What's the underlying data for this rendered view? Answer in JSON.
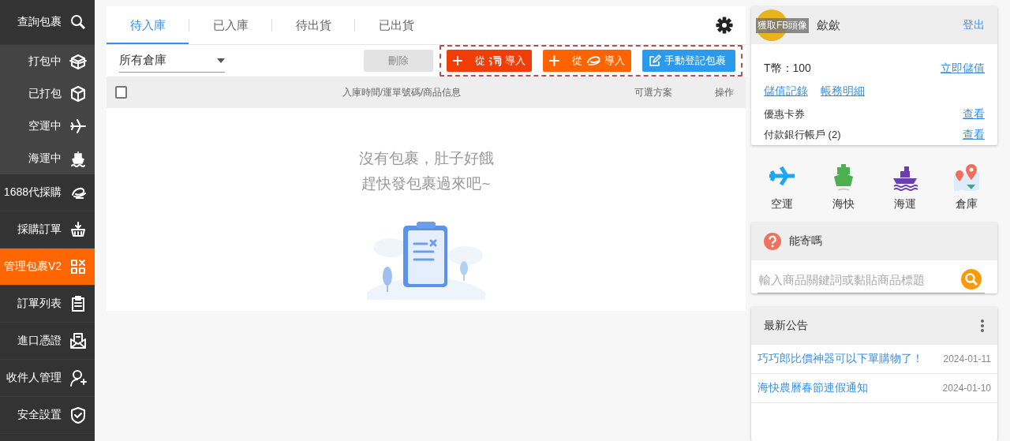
{
  "sidebar": {
    "items": [
      {
        "label": "查詢包裹",
        "kind": "main",
        "selected": false
      },
      {
        "label": "打包中",
        "kind": "sub",
        "selected": false
      },
      {
        "label": "已打包",
        "kind": "sub",
        "selected": false
      },
      {
        "label": "空運中",
        "kind": "sub",
        "selected": false
      },
      {
        "label": "海運中",
        "kind": "sub",
        "selected": false
      },
      {
        "label": "1688代採購",
        "kind": "main",
        "selected": false
      },
      {
        "label": "採購訂單",
        "kind": "main",
        "selected": false
      },
      {
        "label": "管理包裹V2",
        "kind": "main",
        "selected": true
      },
      {
        "label": "訂單列表",
        "kind": "main",
        "selected": false
      },
      {
        "label": "進口憑證",
        "kind": "main",
        "selected": false
      },
      {
        "label": "收件人管理",
        "kind": "main",
        "selected": false
      },
      {
        "label": "安全設置",
        "kind": "main",
        "selected": false
      }
    ]
  },
  "tabs": [
    {
      "label": "待入庫",
      "selected": true
    },
    {
      "label": "已入庫",
      "selected": false
    },
    {
      "label": "待出貨",
      "selected": false
    },
    {
      "label": "已出貨",
      "selected": false
    }
  ],
  "toolbar": {
    "warehouse": "所有倉庫",
    "delete": {
      "label": "刪除",
      "disabled": true
    },
    "buttons": [
      {
        "kind": "taobao",
        "prefix": "從",
        "suffix": "導入"
      },
      {
        "kind": "alibaba",
        "prefix": "從",
        "suffix": "導入"
      },
      {
        "kind": "manual",
        "label": "手動登記包裹"
      }
    ]
  },
  "table": {
    "select_all": {
      "checked": false
    },
    "columns": [
      "入庫時間/運單號碼/商品信息",
      "可選方案",
      "操作"
    ]
  },
  "empty_state": {
    "lines": [
      "沒有包裹，肚子好餓",
      "趕快發包裹過來吧~"
    ]
  },
  "account": {
    "avatar_label": "獲取FB頭像",
    "name": "歛歛",
    "logout": "登出",
    "balance": "T幣：100",
    "topup": "立即儲值",
    "links": [
      "儲值記錄",
      "帳務明細"
    ],
    "rows": [
      {
        "label": "優惠卡券",
        "link": "查看"
      },
      {
        "label": "付款銀行帳戶 (2)",
        "link": "查看"
      }
    ]
  },
  "services": [
    "空運",
    "海快",
    "海運",
    "倉庫"
  ],
  "can_ship": {
    "title": "能寄嗎",
    "placeholder": "輸入商品關鍵詞或黏貼商品標題"
  },
  "news": {
    "title": "最新公告",
    "items": [
      {
        "title": "巧巧郎比價神器可以下單購物了！",
        "date": "2024-01-11"
      },
      {
        "title": "海快農曆春節連假通知",
        "date": "2024-01-10"
      }
    ]
  }
}
